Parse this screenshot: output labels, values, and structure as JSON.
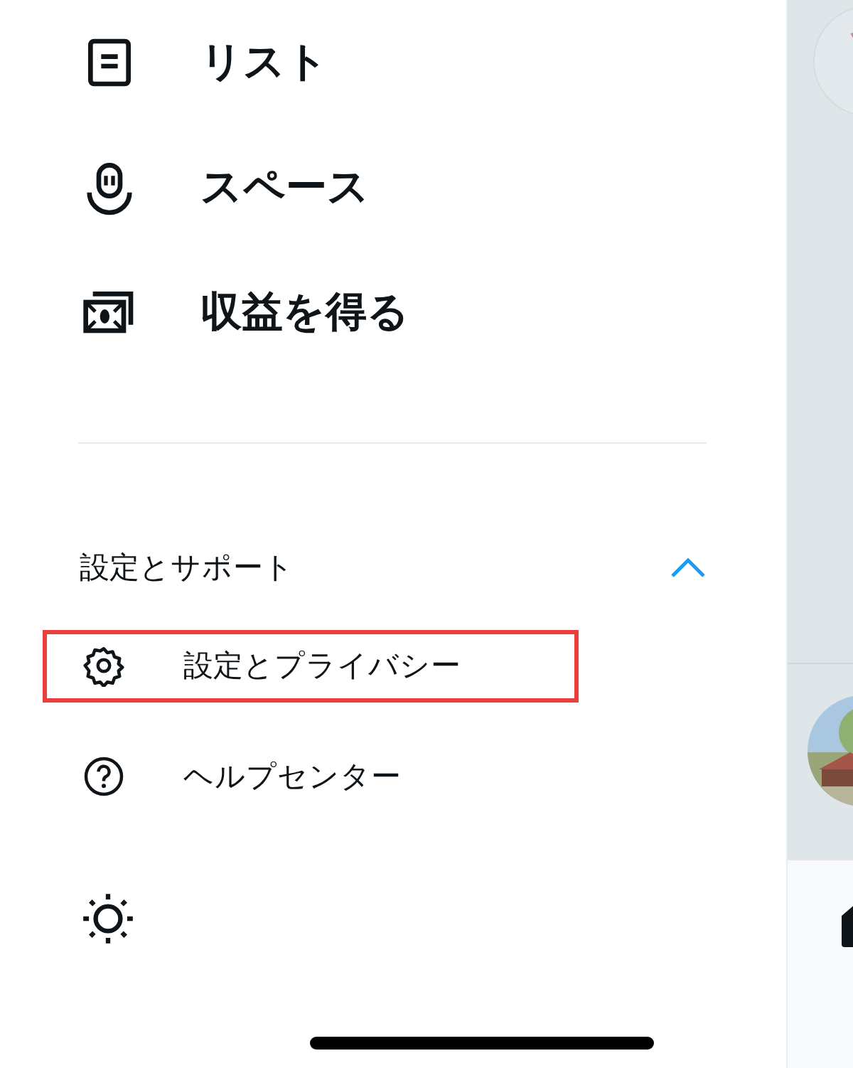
{
  "menu_items": [
    {
      "kind": "list",
      "label": "リスト"
    },
    {
      "kind": "spaces",
      "label": "スペース"
    },
    {
      "kind": "money",
      "label": "収益を得る"
    }
  ],
  "section": {
    "title": "設定とサポート",
    "expanded": true,
    "items": [
      {
        "kind": "gear",
        "label": "設定とプライバシー",
        "highlighted": true
      },
      {
        "kind": "help",
        "label": "ヘルプセンター",
        "highlighted": false
      }
    ]
  },
  "display_toggle": {
    "kind": "sun"
  }
}
